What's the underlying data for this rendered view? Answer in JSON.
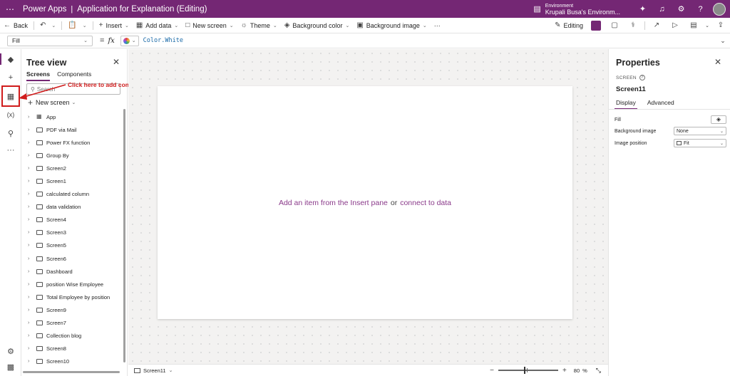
{
  "topbar": {
    "app_name": "Power Apps",
    "separator": "|",
    "doc_title": "Application for Explanation (Editing)",
    "env_label": "Environment",
    "env_name": "Krupali Busa's Environm..."
  },
  "commandbar": {
    "back": "Back",
    "insert": "Insert",
    "add_data": "Add data",
    "new_screen": "New screen",
    "theme": "Theme",
    "background_color": "Background color",
    "background_image": "Background image",
    "more": "···",
    "editing": "Editing"
  },
  "formulabar": {
    "property": "Fill",
    "equals": "=",
    "fx": "fx",
    "formula": "Color.White"
  },
  "treeview": {
    "title": "Tree view",
    "tabs": [
      "Screens",
      "Components"
    ],
    "search_placeholder": "Search",
    "new_screen": "New screen",
    "items": [
      "App",
      "PDF via Mail",
      "Power FX function",
      "Group By",
      "Screen2",
      "Screen1",
      "calculated column",
      "data validation",
      "Screen4",
      "Screen3",
      "Screen5",
      "Screen6",
      "Dashboard",
      "position Wise Employee",
      "Total Employee by position",
      "Screen9",
      "Screen7",
      "Collection blog",
      "Screen8",
      "Screen10"
    ]
  },
  "annotation": {
    "text": "Click here to add connector",
    "color": "#d01c1c"
  },
  "canvas": {
    "placeholder_part1": "Add an item from the Insert pane",
    "placeholder_or": "or",
    "placeholder_part2": "connect to data"
  },
  "bottombar": {
    "screen": "Screen11",
    "zoom_pct": "80",
    "zoom_unit": "%"
  },
  "properties": {
    "title": "Properties",
    "kind": "SCREEN",
    "screen_name": "Screen11",
    "tabs": [
      "Display",
      "Advanced"
    ],
    "fill_label": "Fill",
    "bg_image_label": "Background image",
    "bg_image_value": "None",
    "image_position_label": "Image position",
    "image_position_value": "Fit"
  },
  "colors": {
    "brand": "#742774",
    "annotation": "#d01c1c"
  }
}
